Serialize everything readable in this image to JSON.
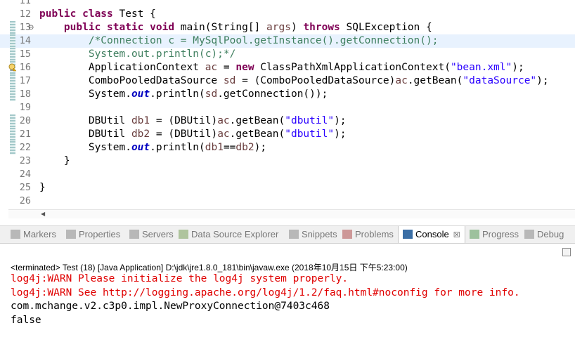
{
  "editor": {
    "lines": [
      {
        "num": "11",
        "parts": []
      },
      {
        "num": "12",
        "parts": [
          {
            "t": "public class",
            "c": "kw"
          },
          {
            "t": " Test {",
            "c": ""
          }
        ]
      },
      {
        "num": "13",
        "fold": "⊖",
        "parts": [
          {
            "t": "    ",
            "c": ""
          },
          {
            "t": "public static void",
            "c": "kw"
          },
          {
            "t": " main(String[] ",
            "c": ""
          },
          {
            "t": "args",
            "c": "var"
          },
          {
            "t": ") ",
            "c": ""
          },
          {
            "t": "throws",
            "c": "kw"
          },
          {
            "t": " SQLException {",
            "c": ""
          }
        ]
      },
      {
        "num": "14",
        "current": true,
        "parts": [
          {
            "t": "        /*Connection c = MySqlPool.getInstance().getConnection();",
            "c": "cm"
          }
        ]
      },
      {
        "num": "15",
        "parts": [
          {
            "t": "        System.out.println(c);*/",
            "c": "cm"
          }
        ]
      },
      {
        "num": "16",
        "parts": [
          {
            "t": "        ApplicationContext ",
            "c": ""
          },
          {
            "t": "ac",
            "c": "var"
          },
          {
            "t": " = ",
            "c": ""
          },
          {
            "t": "new",
            "c": "kw"
          },
          {
            "t": " ClassPathXmlApplicationContext(",
            "c": ""
          },
          {
            "t": "\"bean.xml\"",
            "c": "str"
          },
          {
            "t": ");",
            "c": ""
          }
        ]
      },
      {
        "num": "17",
        "parts": [
          {
            "t": "        ComboPooledDataSource ",
            "c": ""
          },
          {
            "t": "sd",
            "c": "var"
          },
          {
            "t": " = (ComboPooledDataSource)",
            "c": ""
          },
          {
            "t": "ac",
            "c": "var"
          },
          {
            "t": ".getBean(",
            "c": ""
          },
          {
            "t": "\"dataSource\"",
            "c": "str"
          },
          {
            "t": ");",
            "c": ""
          }
        ]
      },
      {
        "num": "18",
        "parts": [
          {
            "t": "        System.",
            "c": ""
          },
          {
            "t": "out",
            "c": "fld"
          },
          {
            "t": ".println(",
            "c": ""
          },
          {
            "t": "sd",
            "c": "var"
          },
          {
            "t": ".getConnection());",
            "c": ""
          }
        ]
      },
      {
        "num": "19",
        "parts": []
      },
      {
        "num": "20",
        "parts": [
          {
            "t": "        DBUtil ",
            "c": ""
          },
          {
            "t": "db1",
            "c": "var"
          },
          {
            "t": " = (DBUtil)",
            "c": ""
          },
          {
            "t": "ac",
            "c": "var"
          },
          {
            "t": ".getBean(",
            "c": ""
          },
          {
            "t": "\"dbutil\"",
            "c": "str"
          },
          {
            "t": ");",
            "c": ""
          }
        ]
      },
      {
        "num": "21",
        "parts": [
          {
            "t": "        DBUtil ",
            "c": ""
          },
          {
            "t": "db2",
            "c": "var"
          },
          {
            "t": " = (DBUtil)",
            "c": ""
          },
          {
            "t": "ac",
            "c": "var"
          },
          {
            "t": ".getBean(",
            "c": ""
          },
          {
            "t": "\"dbutil\"",
            "c": "str"
          },
          {
            "t": ");",
            "c": ""
          }
        ]
      },
      {
        "num": "22",
        "parts": [
          {
            "t": "        System.",
            "c": ""
          },
          {
            "t": "out",
            "c": "fld"
          },
          {
            "t": ".println(",
            "c": ""
          },
          {
            "t": "db1",
            "c": "var"
          },
          {
            "t": "==",
            "c": ""
          },
          {
            "t": "db2",
            "c": "var"
          },
          {
            "t": ");",
            "c": ""
          }
        ]
      },
      {
        "num": "23",
        "parts": [
          {
            "t": "    }",
            "c": ""
          }
        ]
      },
      {
        "num": "24",
        "parts": []
      },
      {
        "num": "25",
        "parts": [
          {
            "t": "}",
            "c": ""
          }
        ]
      },
      {
        "num": "26",
        "parts": []
      }
    ]
  },
  "tabs": [
    {
      "label": "Markers",
      "icon": "markers-icon",
      "color": "#8a8a8a"
    },
    {
      "label": "Properties",
      "icon": "properties-icon",
      "color": "#8a8a8a"
    },
    {
      "label": "Servers",
      "icon": "servers-icon",
      "color": "#8a8a8a"
    },
    {
      "label": "Data Source Explorer",
      "icon": "data-source-explorer-icon",
      "color": "#7aa05a"
    },
    {
      "label": "Snippets",
      "icon": "snippets-icon",
      "color": "#8a8a8a"
    },
    {
      "label": "Problems",
      "icon": "problems-icon",
      "color": "#b05050"
    },
    {
      "label": "Console",
      "icon": "console-icon",
      "color": "#3a6ea5",
      "active": true,
      "close": "☒"
    },
    {
      "label": "Progress",
      "icon": "progress-icon",
      "color": "#5a9a5a"
    },
    {
      "label": "Debug",
      "icon": "debug-icon",
      "color": "#8a8a8a"
    }
  ],
  "console": {
    "terminated": "<terminated> Test (18) [Java Application] D:\\jdk\\jre1.8.0_181\\bin\\javaw.exe (2018年10月15日 下午5:23:00)",
    "output": [
      {
        "text": "log4j:WARN Please initialize the log4j system properly.",
        "type": "err"
      },
      {
        "text": "log4j:WARN See http://logging.apache.org/log4j/1.2/faq.html#noconfig for more info.",
        "type": "err"
      },
      {
        "text": "com.mchange.v2.c3p0.impl.NewProxyConnection@7403c468",
        "type": "std"
      },
      {
        "text": "false",
        "type": "std"
      }
    ]
  },
  "colors": {
    "error": "#e00000",
    "keyword": "#7f0055",
    "comment": "#3f7f5f",
    "string": "#2a00ff"
  }
}
